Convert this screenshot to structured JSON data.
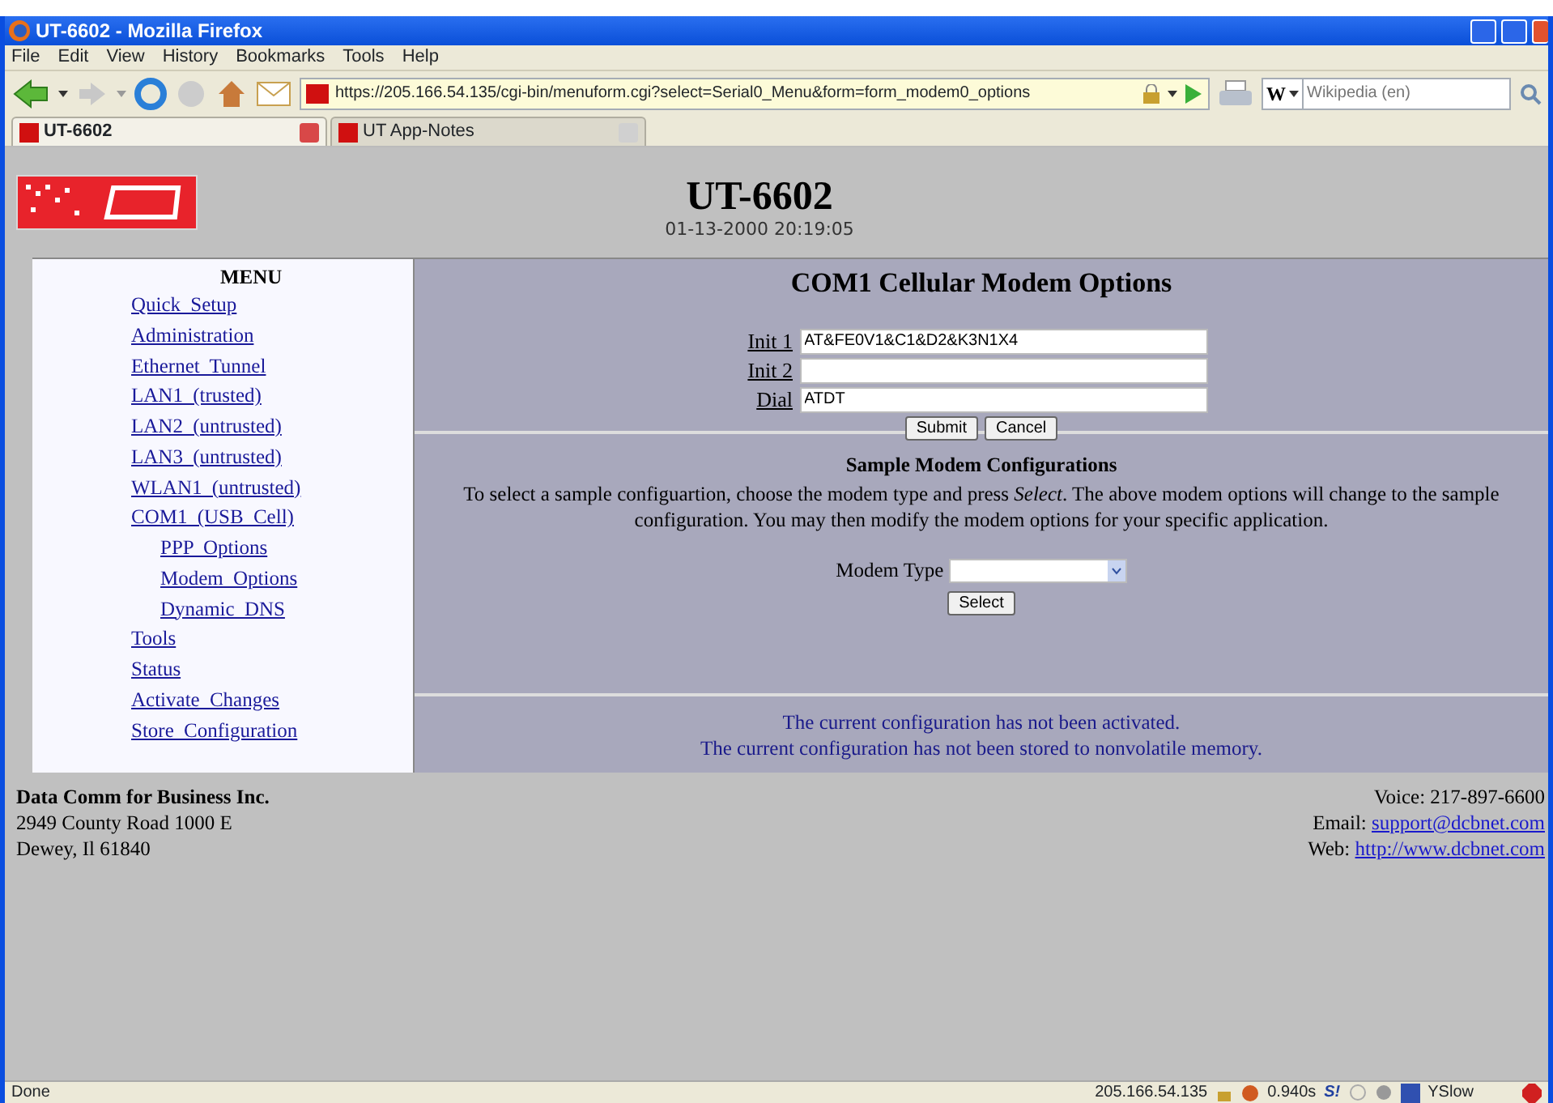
{
  "window": {
    "title": "UT-6602 - Mozilla Firefox"
  },
  "menu_bar": [
    "File",
    "Edit",
    "View",
    "History",
    "Bookmarks",
    "Tools",
    "Help"
  ],
  "toolbar": {
    "url": "https://205.166.54.135/cgi-bin/menuform.cgi?select=Serial0_Menu&form=form_modem0_options",
    "search_engine": "W",
    "search_placeholder": "Wikipedia (en)"
  },
  "tabs": [
    {
      "label": "UT-6602",
      "selected": true
    },
    {
      "label": "UT App-Notes",
      "selected": false
    }
  ],
  "page": {
    "title": "UT-6602",
    "datetime": "01-13-2000 20:19:05"
  },
  "menu": {
    "heading": "MENU",
    "items": [
      {
        "label": "Quick Setup"
      },
      {
        "label": "Administration"
      },
      {
        "label": "Ethernet Tunnel"
      },
      {
        "label": "LAN1 (trusted)"
      },
      {
        "label": "LAN2 (untrusted)"
      },
      {
        "label": "LAN3 (untrusted)"
      },
      {
        "label": "WLAN1 (untrusted)"
      },
      {
        "label": "COM1 (USB Cell)",
        "children": [
          {
            "label": "PPP Options"
          },
          {
            "label": "Modem Options"
          },
          {
            "label": "Dynamic DNS"
          }
        ]
      },
      {
        "label": "Tools"
      },
      {
        "label": "Status"
      },
      {
        "label": "Activate Changes"
      },
      {
        "label": "Store Configuration"
      }
    ]
  },
  "form": {
    "title": "COM1 Cellular Modem Options",
    "fields": [
      {
        "label": "Init 1",
        "value": "AT&FE0V1&C1&D2&K3N1X4"
      },
      {
        "label": "Init 2"
      },
      {
        "label": "Dial",
        "value": "ATDT"
      }
    ],
    "buttons": [
      "Submit",
      "Cancel"
    ]
  },
  "sample": {
    "heading": "Sample Modem Configurations",
    "description": "To select a sample configuartion, choose the modem type and press *Select*. The above modem options will change to the sample configuration. You may then modify the modem options for your specific application.",
    "modem_type_label": "Modem Type",
    "button": "Select"
  },
  "notices": [
    "The current configuration has not been activated.",
    "The current configuration has not been stored to nonvolatile memory."
  ],
  "footer": {
    "company": "Data Comm for Business Inc.",
    "address": [
      "2949 County Road 1000 E",
      "Dewey, Il 61840"
    ],
    "voice": "Voice: 217-897-6600",
    "email_label": "Email:",
    "email": "support@dcbnet.com",
    "web_label": "Web:",
    "web": "http://www.dcbnet.com"
  },
  "status_bar": {
    "text": "Done",
    "ip": "205.166.54.135",
    "time": "0.940s",
    "s_label": "S!",
    "yslow": "YSlow"
  }
}
